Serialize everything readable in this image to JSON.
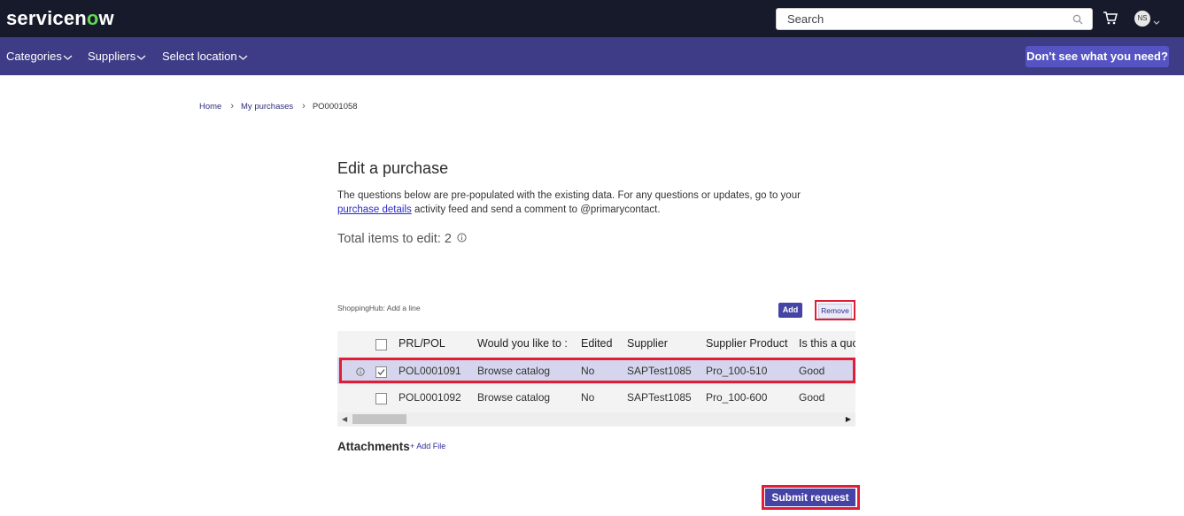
{
  "header": {
    "logo_text_a": "servicen",
    "logo_text_b": "o",
    "logo_text_c": "w",
    "search_placeholder": "Search",
    "avatar_initials": "NS"
  },
  "nav": {
    "categories": "Categories",
    "suppliers": "Suppliers",
    "location": "Select location",
    "dont_see": "Don't see what you need?"
  },
  "breadcrumb": {
    "home": "Home",
    "my_purchases": "My purchases",
    "current": "PO0001058"
  },
  "page": {
    "title": "Edit a purchase",
    "desc_part1": "The questions below are pre-populated with the existing data.  For any questions or updates, go to your",
    "desc_link": "purchase details",
    "desc_part2": " activity feed and send a comment to @primarycontact.",
    "total_label": "Total items to edit: 2"
  },
  "lines": {
    "caption": "ShoppingHub: Add a line",
    "add_label": "Add",
    "remove_label": "Remove",
    "columns": [
      "PRL/POL",
      "Would you like to :",
      "Edited",
      "Supplier",
      "Supplier Product",
      "Is this a quo"
    ],
    "rows": [
      {
        "pol": "POL0001091",
        "action": "Browse catalog",
        "edited": "No",
        "supplier": "SAPTest1085",
        "product": "Pro_100-510",
        "quote": "Good",
        "checked": true
      },
      {
        "pol": "POL0001092",
        "action": "Browse catalog",
        "edited": "No",
        "supplier": "SAPTest1085",
        "product": "Pro_100-600",
        "quote": "Good",
        "checked": false
      }
    ]
  },
  "attachments": {
    "label": "Attachments",
    "add_file": "+ Add File"
  },
  "submit_label": "Submit request",
  "colors": {
    "topbar": "#171a2b",
    "navbar": "#3e3c86",
    "accent": "#4543a6",
    "highlight": "#e01e37",
    "selected_row": "#d5d6ee"
  }
}
